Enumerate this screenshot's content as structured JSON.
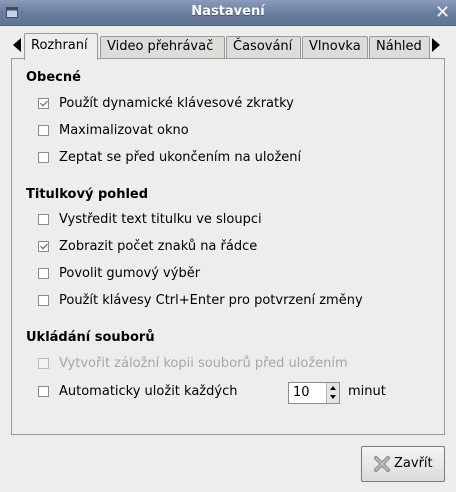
{
  "window": {
    "title": "Nastavení"
  },
  "tabs": [
    {
      "label": "Rozhraní",
      "active": true
    },
    {
      "label": "Video přehrávač"
    },
    {
      "label": "Časování"
    },
    {
      "label": "Vlnovka"
    },
    {
      "label": "Náhled"
    }
  ],
  "sections": {
    "general": {
      "title": "Obecné",
      "items": [
        {
          "label": "Použít dynamické klávesové zkratky",
          "checked": true
        },
        {
          "label": "Maximalizovat okno",
          "checked": false
        },
        {
          "label": "Zeptat se před ukončením na uložení",
          "checked": false
        }
      ]
    },
    "subtitle_view": {
      "title": "Titulkový pohled",
      "items": [
        {
          "label": "Vystředit text titulku ve sloupci",
          "checked": false
        },
        {
          "label": "Zobrazit počet znaků na řádce",
          "checked": true
        },
        {
          "label": "Povolit gumový výběr",
          "checked": false
        },
        {
          "label": "Použít klávesy Ctrl+Enter pro potvrzení změny",
          "checked": false
        }
      ]
    },
    "saving": {
      "title": "Ukládání souborů",
      "backup": {
        "label": "Vytvořit záložní kopii souborů před uložením",
        "checked": false,
        "disabled": true
      },
      "autosave": {
        "label": "Automaticky uložit každých",
        "checked": false,
        "value": "10",
        "unit": "minut"
      }
    }
  },
  "buttons": {
    "close": "Zavřít"
  }
}
